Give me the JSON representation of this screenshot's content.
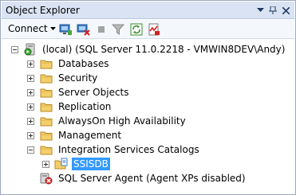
{
  "window": {
    "title": "Object Explorer",
    "buttons": [
      "dropdown",
      "pin",
      "close"
    ]
  },
  "toolbar": {
    "connect_label": "Connect",
    "icons": [
      "connect-object-explorer-icon",
      "disconnect-icon",
      "stop-icon",
      "filter-icon",
      "refresh-icon",
      "activity-monitor-icon"
    ]
  },
  "tree": {
    "server": "(local) (SQL Server 11.0.2218 - VMWIN8DEV\\Andy)",
    "folders": {
      "databases": "Databases",
      "security": "Security",
      "server_objects": "Server Objects",
      "replication": "Replication",
      "alwayson": "AlwaysOn High Availability",
      "management": "Management",
      "is_catalogs": "Integration Services Catalogs"
    },
    "ssisdb": "SSISDB",
    "agent": "SQL Server Agent (Agent XPs disabled)"
  },
  "colors": {
    "selection": "#3399ff",
    "titlebar": "#d9e3f3",
    "folder": "#e8b84a"
  }
}
